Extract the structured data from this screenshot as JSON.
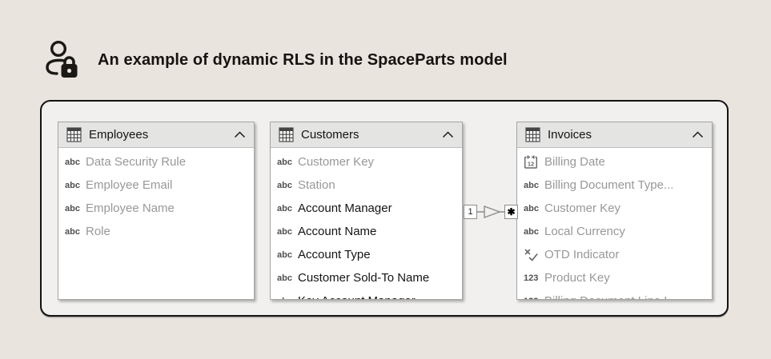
{
  "page": {
    "background_color": "#e9e5de",
    "canvas_background": "#f1f0ee",
    "canvas_border_color": "#131313",
    "card_header_color": "#e4e4e3",
    "muted_text_color": "#989898",
    "dark_text_color": "#141414"
  },
  "header": {
    "title": "An example of dynamic RLS in the SpaceParts model",
    "icon": "user-lock-icon"
  },
  "tables": [
    {
      "name": "Employees",
      "header_icon": "table-grid-icon",
      "collapse_icon": "chevron-up-icon",
      "fields": [
        {
          "icon": "abc",
          "label": "Data Security Rule",
          "muted": true
        },
        {
          "icon": "abc",
          "label": "Employee Email",
          "muted": true
        },
        {
          "icon": "abc",
          "label": "Employee Name",
          "muted": true
        },
        {
          "icon": "abc",
          "label": "Role",
          "muted": true
        }
      ]
    },
    {
      "name": "Customers",
      "header_icon": "table-grid-icon",
      "collapse_icon": "chevron-up-icon",
      "fields": [
        {
          "icon": "abc",
          "label": "Customer Key",
          "muted": true
        },
        {
          "icon": "abc",
          "label": "Station",
          "muted": true
        },
        {
          "icon": "abc",
          "label": "Account Manager",
          "muted": false
        },
        {
          "icon": "abc",
          "label": "Account Name",
          "muted": false
        },
        {
          "icon": "abc",
          "label": "Account Type",
          "muted": false
        },
        {
          "icon": "abc",
          "label": "Customer Sold-To Name",
          "muted": false
        },
        {
          "icon": "abc",
          "label": "Key Account Manager",
          "muted": false,
          "clipped": true
        }
      ]
    },
    {
      "name": "Invoices",
      "header_icon": "table-grid-icon",
      "collapse_icon": "chevron-up-icon",
      "fields": [
        {
          "icon": "calendar",
          "label": "Billing Date",
          "muted": true
        },
        {
          "icon": "abc",
          "label": "Billing Document Type...",
          "muted": true
        },
        {
          "icon": "abc",
          "label": "Customer Key",
          "muted": true
        },
        {
          "icon": "abc",
          "label": "Local Currency",
          "muted": true
        },
        {
          "icon": "x-check",
          "label": "OTD Indicator",
          "muted": true
        },
        {
          "icon": "123",
          "label": "Product Key",
          "muted": true
        },
        {
          "icon": "123",
          "label": "Billing Document Line I",
          "muted": true,
          "clipped": true
        }
      ]
    }
  ],
  "relationship": {
    "one_label": "1",
    "many_label": "✱",
    "arrow_direction": "right"
  }
}
